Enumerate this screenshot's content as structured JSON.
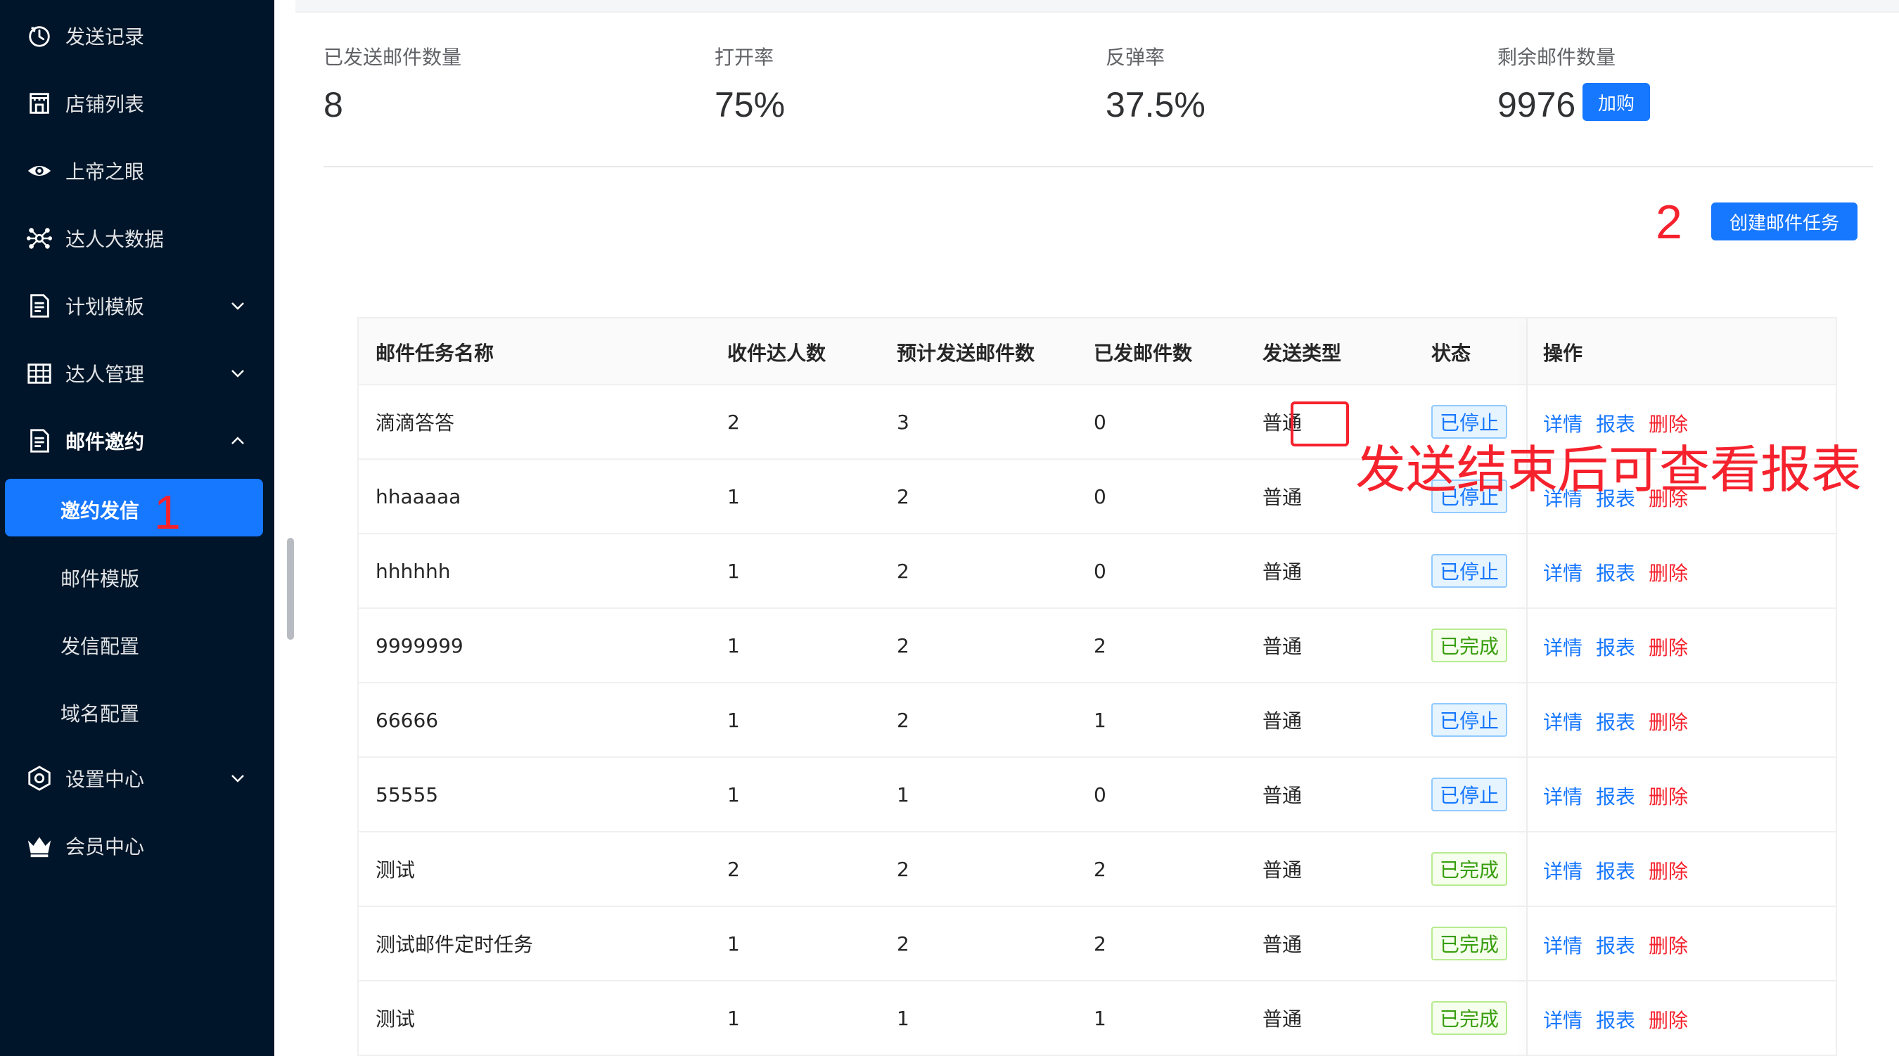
{
  "sidebar": {
    "items": [
      {
        "label": "发送记录",
        "icon": "history-icon",
        "expandable": false
      },
      {
        "label": "店铺列表",
        "icon": "shop-icon",
        "expandable": false
      },
      {
        "label": "上帝之眼",
        "icon": "eye-icon",
        "expandable": false
      },
      {
        "label": "达人大数据",
        "icon": "network-icon",
        "expandable": false
      },
      {
        "label": "计划模板",
        "icon": "document-icon",
        "expandable": true,
        "expanded": false
      },
      {
        "label": "达人管理",
        "icon": "table-icon",
        "expandable": true,
        "expanded": false
      },
      {
        "label": "邮件邀约",
        "icon": "document-icon",
        "expandable": true,
        "expanded": true
      },
      {
        "label": "设置中心",
        "icon": "settings-icon",
        "expandable": true,
        "expanded": false
      },
      {
        "label": "会员中心",
        "icon": "crown-icon",
        "expandable": false
      }
    ],
    "sub_items": [
      {
        "label": "邀约发信",
        "active": true
      },
      {
        "label": "邮件模版",
        "active": false
      },
      {
        "label": "发信配置",
        "active": false
      },
      {
        "label": "域名配置",
        "active": false
      }
    ],
    "annotation": "1"
  },
  "stats": [
    {
      "title": "已发送邮件数量",
      "value": "8"
    },
    {
      "title": "打开率",
      "value": "75%"
    },
    {
      "title": "反弹率",
      "value": "37.5%"
    },
    {
      "title": "剩余邮件数量",
      "value": "9976"
    }
  ],
  "buy_label": "加购",
  "create_label": "创建邮件任务",
  "annotation_2": "2",
  "annotation_3": "发送结束后可查看报表",
  "table": {
    "columns": [
      "邮件任务名称",
      "收件达人数",
      "预计发送邮件数",
      "已发邮件数",
      "发送类型",
      "状态",
      "操作"
    ],
    "actions": {
      "detail": "详情",
      "report": "报表",
      "delete": "删除"
    },
    "rows": [
      {
        "name": "滴滴答答",
        "recipients": "2",
        "planned": "3",
        "sent": "0",
        "type": "普通",
        "status": "已停止",
        "status_kind": "stopped"
      },
      {
        "name": "hhaaaaa",
        "recipients": "1",
        "planned": "2",
        "sent": "0",
        "type": "普通",
        "status": "已停止",
        "status_kind": "stopped"
      },
      {
        "name": "hhhhhh",
        "recipients": "1",
        "planned": "2",
        "sent": "0",
        "type": "普通",
        "status": "已停止",
        "status_kind": "stopped"
      },
      {
        "name": "9999999",
        "recipients": "1",
        "planned": "2",
        "sent": "2",
        "type": "普通",
        "status": "已完成",
        "status_kind": "done"
      },
      {
        "name": "66666",
        "recipients": "1",
        "planned": "2",
        "sent": "1",
        "type": "普通",
        "status": "已停止",
        "status_kind": "stopped"
      },
      {
        "name": "55555",
        "recipients": "1",
        "planned": "1",
        "sent": "0",
        "type": "普通",
        "status": "已停止",
        "status_kind": "stopped"
      },
      {
        "name": "测试",
        "recipients": "2",
        "planned": "2",
        "sent": "2",
        "type": "普通",
        "status": "已完成",
        "status_kind": "done"
      },
      {
        "name": "测试邮件定时任务",
        "recipients": "1",
        "planned": "2",
        "sent": "2",
        "type": "普通",
        "status": "已完成",
        "status_kind": "done"
      },
      {
        "name": "测试",
        "recipients": "1",
        "planned": "1",
        "sent": "1",
        "type": "普通",
        "status": "已完成",
        "status_kind": "done"
      }
    ]
  }
}
